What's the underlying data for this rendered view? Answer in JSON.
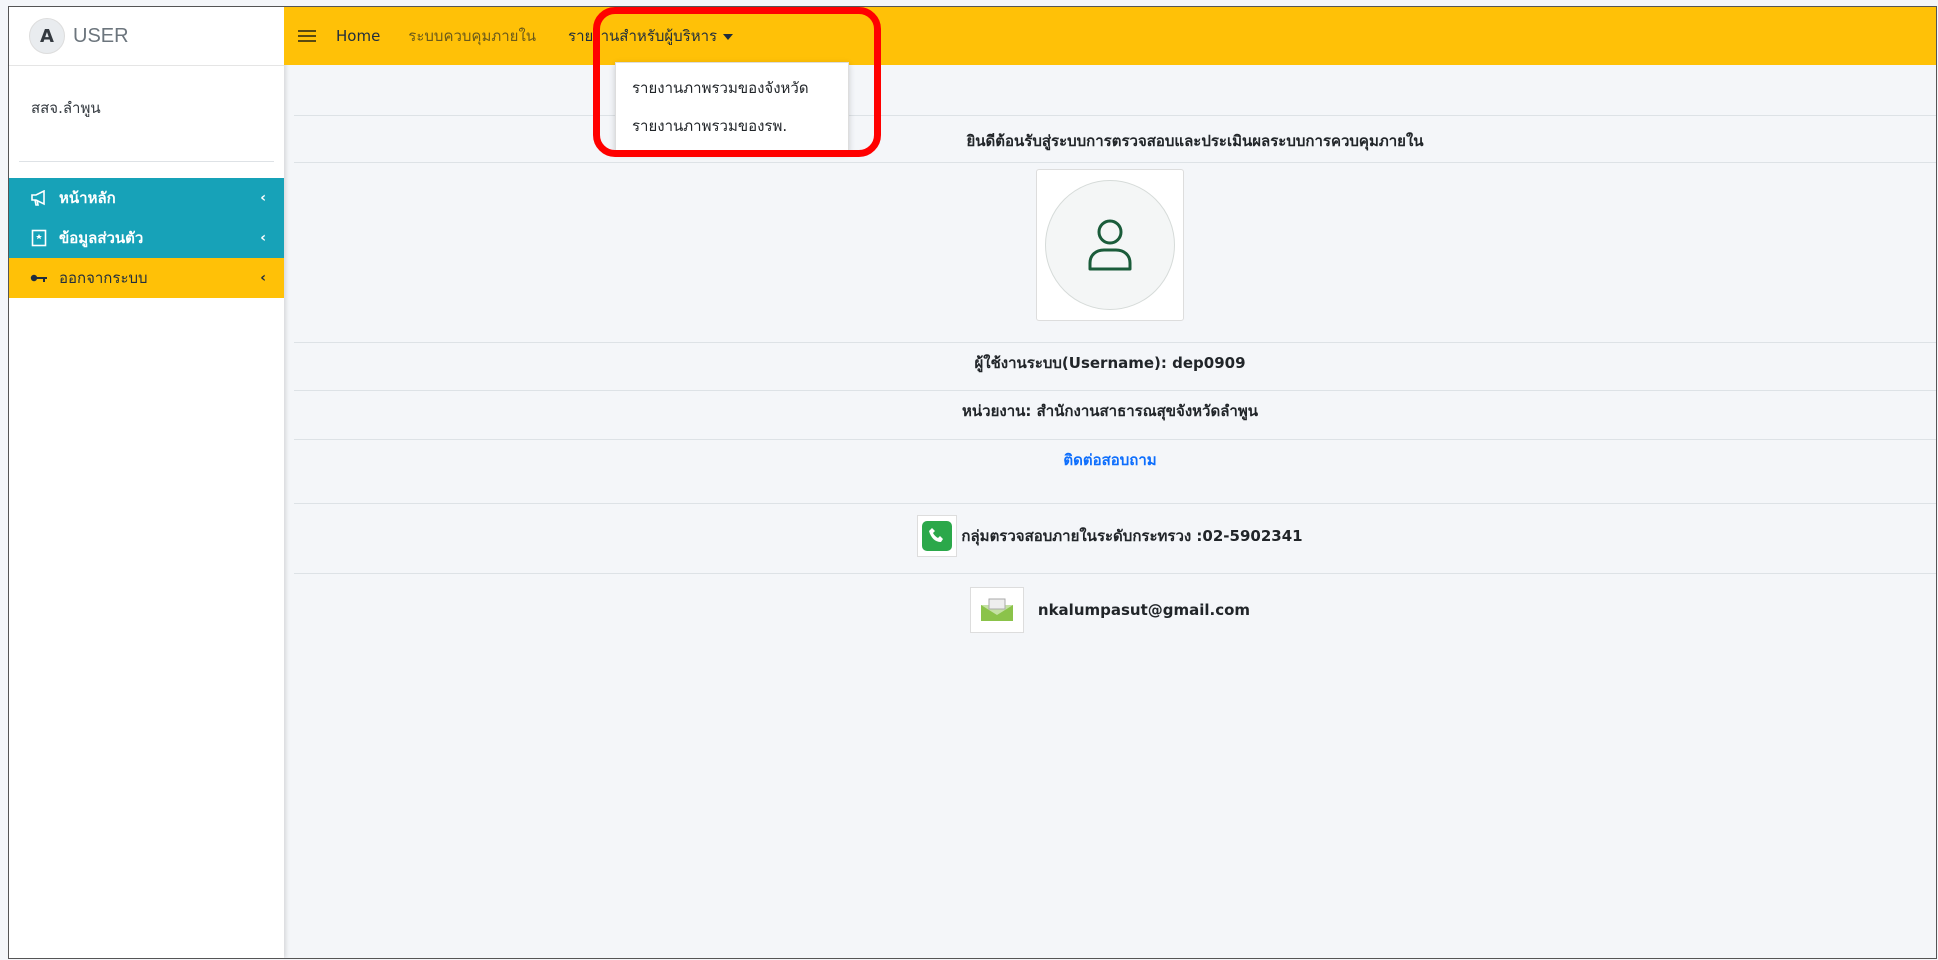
{
  "brand": {
    "logo_letter": "A",
    "title": "USER"
  },
  "sidebar": {
    "user_name": "สสจ.ลำพูน",
    "items": [
      {
        "label": "หน้าหลัก",
        "icon": "megaphone-icon",
        "color": "#17a2b8"
      },
      {
        "label": "ข้อมูลส่วนตัว",
        "icon": "id-card-icon",
        "color": "#17a2b8"
      },
      {
        "label": "ออกจากระบบ",
        "icon": "key-icon",
        "color": "#ffc107"
      }
    ]
  },
  "topbar": {
    "color": "#ffc107",
    "links": [
      "Home",
      "ระบบควบคุมภายใน",
      "รายงานสำหรับผู้บริหาร"
    ]
  },
  "dropdown": {
    "items": [
      "รายงานภาพรวมของจังหวัด",
      "รายงานภาพรวมของรพ."
    ]
  },
  "main": {
    "welcome": "ยินดีต้อนรับสู่ระบบการตรวจสอบและประเมินผลระบบการควบคุมภายใน",
    "username_line": "ผู้ใช้งานระบบ(Username): dep0909",
    "unit_line": "หน่วยงาน: สำนักงานสาธารณสุขจังหวัดลำพูน",
    "contact_heading": "ติดต่อสอบถาม",
    "phone_line": "กลุ่มตรวจสอบภายในระดับกระทรวง :02-5902341",
    "email": "nkalumpasut@gmail.com"
  },
  "highlight_color": "#ff0000"
}
